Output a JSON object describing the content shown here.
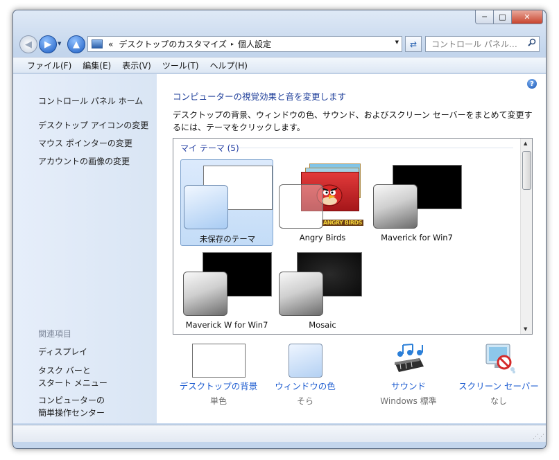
{
  "window": {
    "controls": {
      "minimize": "─",
      "maximize": "□",
      "close": "✕"
    }
  },
  "nav": {
    "back_glyph": "◀",
    "forward_glyph": "▶",
    "dropdown_glyph": "▼",
    "up_glyph": "▲",
    "address_prefix": "«",
    "breadcrumb": [
      "デスクトップのカスタマイズ",
      "個人設定"
    ],
    "breadcrumb_separator": "▸",
    "refresh_glyph": "⇄",
    "search_placeholder": "コントロール パネル…"
  },
  "menubar": {
    "items": [
      "ファイル(F)",
      "編集(E)",
      "表示(V)",
      "ツール(T)",
      "ヘルプ(H)"
    ]
  },
  "sidebar": {
    "home": "コントロール パネル ホーム",
    "links": [
      "デスクトップ アイコンの変更",
      "マウス ポインターの変更",
      "アカウントの画像の変更"
    ],
    "related_heading": "関連項目",
    "related": [
      [
        "ディスプレイ"
      ],
      [
        "タスク バーと",
        "スタート メニュー"
      ],
      [
        "コンピューターの",
        "簡単操作センター"
      ]
    ]
  },
  "content": {
    "help_glyph": "?",
    "title": "コンピューターの視覚効果と音を変更します",
    "description": "デスクトップの背景、ウィンドウの色、サウンド、およびスクリーン セーバーをまとめて変更するには、テーマをクリックします。",
    "group_header": "マイ テーマ (5)",
    "themes": [
      {
        "name": "未保存のテーマ",
        "selected": true,
        "style": "white"
      },
      {
        "name": "Angry Birds",
        "selected": false,
        "style": "angrybirds"
      },
      {
        "name": "Maverick for Win7",
        "selected": false,
        "style": "dark"
      },
      {
        "name": "Maverick W for Win7",
        "selected": false,
        "style": "dark"
      },
      {
        "name": "Mosaic",
        "selected": false,
        "style": "mosaic"
      }
    ],
    "angry_birds_logo": "ANGRY BIRDS",
    "options": [
      {
        "label": "デスクトップの背景",
        "sub": "単色"
      },
      {
        "label": "ウィンドウの色",
        "sub": "そら"
      },
      {
        "label": "サウンド",
        "sub": "Windows 標準"
      },
      {
        "label": "スクリーン セーバー",
        "sub": "なし"
      }
    ]
  },
  "colors": {
    "link": "#1d5cd0",
    "title": "#1f3f9a",
    "selected_tile": "#c3dcf7",
    "close_button": "#c8442d"
  }
}
